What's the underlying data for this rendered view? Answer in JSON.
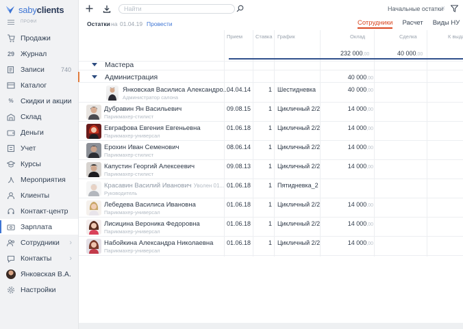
{
  "app": {
    "brand_part1": "saby",
    "brand_part2": "clients",
    "sidebar_caption": "ПРОФИ",
    "brand_color": "#3e75d4"
  },
  "sidebar": {
    "items": [
      {
        "label": "Продажи",
        "icon": "shopping-cart-icon"
      },
      {
        "label": "Журнал",
        "icon": "calendar-29-icon"
      },
      {
        "label": "Записи",
        "icon": "notes-icon",
        "count": "740"
      },
      {
        "label": "Каталог",
        "icon": "catalog-icon"
      },
      {
        "label": "Скидки и акции",
        "icon": "discount-icon"
      },
      {
        "label": "Склад",
        "icon": "warehouse-icon"
      },
      {
        "label": "Деньги",
        "icon": "wallet-icon"
      },
      {
        "label": "Учет",
        "icon": "ledger-icon"
      },
      {
        "label": "Курсы",
        "icon": "graduation-cap-icon"
      },
      {
        "label": "Мероприятия",
        "icon": "events-icon"
      },
      {
        "label": "Клиенты",
        "icon": "clients-icon"
      },
      {
        "label": "Контакт-центр",
        "icon": "headset-icon"
      },
      {
        "label": "Зарплата",
        "icon": "salary-icon",
        "active": true
      },
      {
        "label": "Сотрудники",
        "icon": "employees-icon",
        "has_arrow": true
      },
      {
        "label": "Контакты",
        "icon": "contacts-icon",
        "has_arrow": true
      },
      {
        "label": "Янковская В.А.",
        "icon": "user-avatar"
      },
      {
        "label": "Настройки",
        "icon": "gear-icon"
      }
    ]
  },
  "topbar": {
    "add_icon": "plus-icon",
    "download_icon": "download-icon",
    "search_placeholder": "Найти",
    "initial_balances": "Начальные остатки",
    "close_symbol": "×"
  },
  "subbar": {
    "balances_label": "Остатки",
    "on_label": "на",
    "date": "01.04.19",
    "post_label": "Провести"
  },
  "tabs": [
    "Сотрудники",
    "Расчет",
    "Виды НУ"
  ],
  "columns": {
    "hire": "Прием",
    "rate": "Ставка",
    "schedule": "График",
    "salary": "Оклад",
    "deal": "Сделка",
    "payout": "К выда"
  },
  "totals": {
    "salary": "232 000",
    "salary_kop": ",00",
    "deal": "40 000",
    "deal_kop": ",00"
  },
  "groups": [
    {
      "name": "Мастера",
      "value": ""
    },
    {
      "name": "Администрация",
      "value": "40 000",
      "value_kop": ",00"
    }
  ],
  "employees": [
    {
      "name": "Янковская Василиса Александро...",
      "role": "Администратор салона",
      "date": "04.04.14",
      "rate": "1",
      "schedule": "Шестидневка",
      "salary": "40 000",
      "kop": ",00"
    },
    {
      "name": "Дубравин Ян Васильевич",
      "role": "Парикмахер-стилист",
      "date": "09.08.15",
      "rate": "1",
      "schedule": "Цикличный 2/2",
      "salary": "14 000",
      "kop": ",00"
    },
    {
      "name": "Евграфова Евгения Евгеньевна",
      "role": "Парикмахер-универсал",
      "date": "01.06.18",
      "rate": "1",
      "schedule": "Цикличный 2/2",
      "salary": "14 000",
      "kop": ",00"
    },
    {
      "name": "Ерохин Иван Семенович",
      "role": "Парикмахер-стилист",
      "date": "08.06.14",
      "rate": "1",
      "schedule": "Цикличный 2/2",
      "salary": "14 000",
      "kop": ",00"
    },
    {
      "name": "Капустин Георгий Алексеевич",
      "role": "Парикмахер-стилист",
      "date": "09.08.13",
      "rate": "1",
      "schedule": "Цикличный 2/2",
      "salary": "14 000",
      "kop": ",00"
    },
    {
      "name": "Красавин Василий Иванович",
      "fired": "Уволен 01...",
      "role": "Руководитель",
      "date": "01.06.18",
      "rate": "1",
      "schedule": "Пятидневка_2",
      "salary": "",
      "kop": ""
    },
    {
      "name": "Лебедева Василиса Ивановна",
      "role": "Парикмахер-универсал",
      "date": "01.06.18",
      "rate": "1",
      "schedule": "Цикличный 2/2",
      "salary": "14 000",
      "kop": ",00"
    },
    {
      "name": "Лисицина Вероника Федоровна",
      "role": "Парикмахер-универсал",
      "date": "01.06.18",
      "rate": "1",
      "schedule": "Цикличный 2/2",
      "salary": "14 000",
      "kop": ",00"
    },
    {
      "name": "Набойкина Александра Николаевна",
      "role": "Парикмахер-универсал",
      "date": "01.06.18",
      "rate": "1",
      "schedule": "Цикличный 2/2",
      "salary": "14 000",
      "kop": ",00"
    }
  ]
}
